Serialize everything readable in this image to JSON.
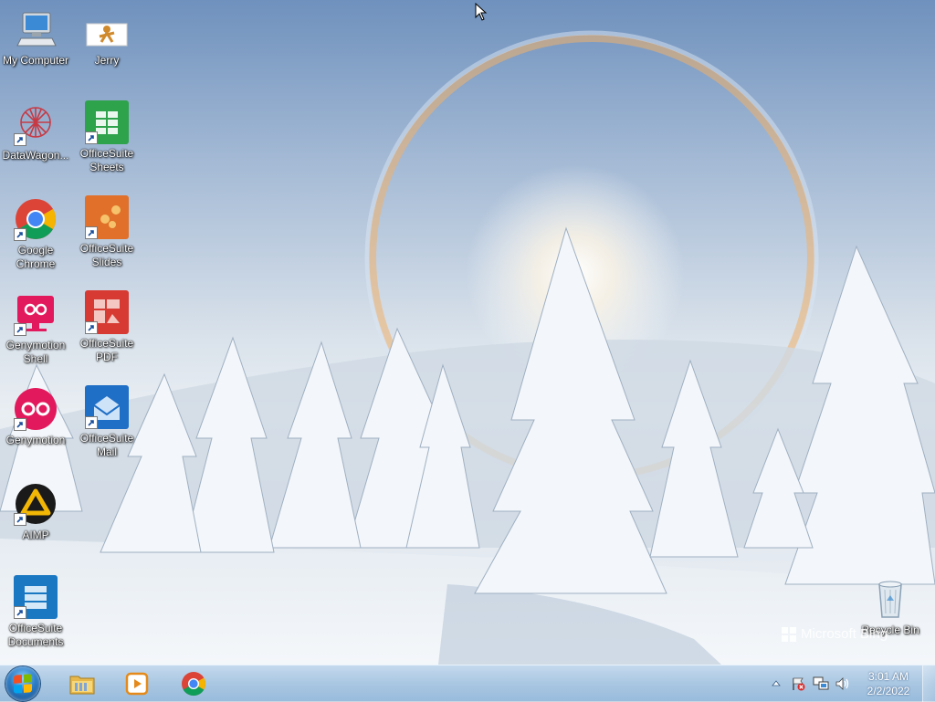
{
  "desktop": {
    "icons": [
      {
        "label": "My Computer"
      },
      {
        "label": "Jerry"
      },
      {
        "label": "DataWagon..."
      },
      {
        "label": "OfficeSuite Sheets"
      },
      {
        "label": "Google Chrome"
      },
      {
        "label": "OfficeSuite Slides"
      },
      {
        "label": "Genymotion Shell"
      },
      {
        "label": "OfficeSuite PDF"
      },
      {
        "label": "Genymotion"
      },
      {
        "label": "OfficeSuite Mail"
      },
      {
        "label": "AIMP"
      },
      {
        "label": "OfficeSuite Documents"
      },
      {
        "label": "Recycle Bin"
      }
    ],
    "watermark": "Microsoft Bing"
  },
  "taskbar": {
    "pinned": [
      {
        "icon": "file-explorer-icon"
      },
      {
        "icon": "media-player-icon"
      },
      {
        "icon": "chrome-icon"
      }
    ],
    "tray": {
      "icons": [
        "show-hidden-icons-arrow",
        "action-center-flag-icon",
        "network-icon",
        "volume-icon"
      ]
    },
    "clock": {
      "time": "3:01 AM",
      "date": "2/2/2022"
    }
  },
  "colors": {
    "taskbar": "#a8c6e2",
    "sheets_green": "#2fa24c",
    "slides_orange": "#e0702a",
    "pdf_red": "#d73a32",
    "mail_blue": "#1f6fc7",
    "docs_blue": "#1a78c2",
    "genymotion_pink": "#e2195c"
  }
}
